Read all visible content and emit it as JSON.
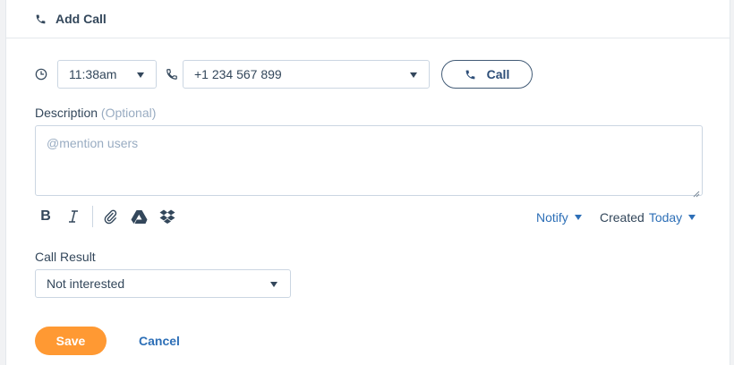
{
  "header": {
    "title": "Add Call",
    "icon": "phone-icon"
  },
  "call": {
    "time_value": "11:38am",
    "phone_value": "+1 234 567 899",
    "call_button_label": "Call"
  },
  "description": {
    "label": "Description",
    "optional_text": "(Optional)",
    "placeholder": "@mention users"
  },
  "toolbar": {
    "bold_label": "B",
    "italic_icon": "italic-icon",
    "attach_icon": "paperclip-icon",
    "drive_icon": "google-drive-icon",
    "dropbox_icon": "dropbox-icon",
    "notify_label": "Notify",
    "created_label": "Created",
    "created_value": "Today"
  },
  "call_result": {
    "label": "Call Result",
    "selected": "Not interested"
  },
  "actions": {
    "save_label": "Save",
    "cancel_label": "Cancel"
  },
  "colors": {
    "accent_orange": "#ff9933",
    "link_blue": "#2d6fb7",
    "text": "#33475b",
    "border": "#cbd6e2"
  }
}
